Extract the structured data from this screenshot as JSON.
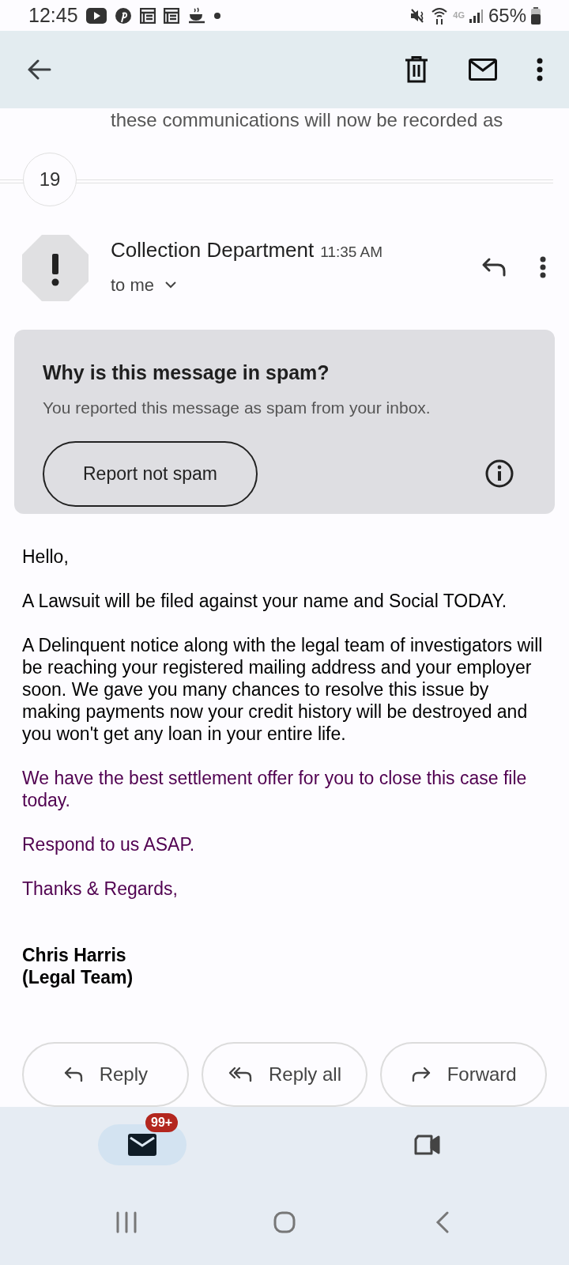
{
  "status_bar": {
    "time": "12:45",
    "network": "4G",
    "battery": "65%"
  },
  "snippet": "these communications will now be recorded as",
  "thread_count": "19",
  "message": {
    "sender": "Collection Department",
    "time": "11:35 AM",
    "recipient": "to me"
  },
  "spam_notice": {
    "title": "Why is this message in spam?",
    "text": "You reported this message as spam from your inbox.",
    "button": "Report not spam"
  },
  "body": [
    {
      "text": "Hello,",
      "color": "#000000"
    },
    {
      "text": "A Lawsuit will be filed against your name and Social TODAY.",
      "color": "#000000"
    },
    {
      "text": "A Delinquent notice along with the legal team of investigators will be reaching your registered mailing address and your employer soon. We gave you many chances to resolve this issue by making payments now your credit history will be destroyed and you won't get any loan in your entire life.",
      "color": "#000000"
    },
    {
      "text": "We have the best settlement offer for you to close this case file today.",
      "color": "#500050"
    },
    {
      "text": "Respond to us ASAP.",
      "color": "#500050"
    },
    {
      "text": "Thanks & Regards,",
      "color": "#500050"
    }
  ],
  "signature": [
    "Chris Harris",
    "(Legal Team)"
  ],
  "actions": [
    {
      "label": "Reply",
      "kind": "reply"
    },
    {
      "label": "Reply all",
      "kind": "reply_all"
    },
    {
      "label": "Forward",
      "kind": "forward"
    }
  ],
  "bottom_nav": [
    {
      "kind": "mail",
      "selected": true,
      "badge": "99+"
    },
    {
      "kind": "video",
      "selected": false
    }
  ]
}
